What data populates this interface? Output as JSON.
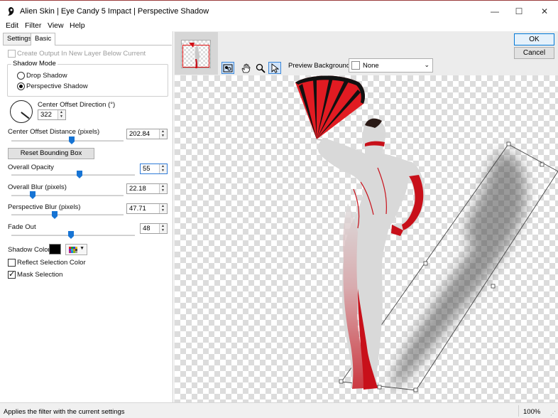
{
  "window": {
    "title": "Alien Skin | Eye Candy 5 Impact | Perspective Shadow",
    "minimize": "—",
    "maximize": "☐",
    "close": "✕"
  },
  "menu": [
    "Edit",
    "Filter",
    "View",
    "Help"
  ],
  "tabs": [
    {
      "label": "Settings",
      "active": false
    },
    {
      "label": "Basic",
      "active": true
    }
  ],
  "basic": {
    "create_output_label": "Create Output In New Layer Below Current",
    "create_output_checked": false,
    "shadow_mode_title": "Shadow Mode",
    "drop_shadow_label": "Drop Shadow",
    "perspective_shadow_label": "Perspective Shadow",
    "selected_mode": "Perspective Shadow",
    "direction_label": "Center Offset Direction (°)",
    "direction_value": "322",
    "distance_label": "Center Offset Distance (pixels)",
    "distance_value": "202.84",
    "reset_button": "Reset Bounding Box",
    "opacity_label": "Overall Opacity",
    "opacity_value": "55",
    "blur_label": "Overall Blur (pixels)",
    "blur_value": "22.18",
    "persp_blur_label": "Perspective Blur (pixels)",
    "persp_blur_value": "47.71",
    "fade_label": "Fade Out",
    "fade_value": "48",
    "shadow_color_label": "Shadow Color",
    "shadow_color": "#000000",
    "reflect_label": "Reflect Selection Color",
    "reflect_checked": false,
    "mask_label": "Mask Selection",
    "mask_checked": true
  },
  "preview": {
    "background_label": "Preview Background:",
    "background_value": "None",
    "tools": [
      "preview-toggle-icon",
      "hand-icon",
      "zoom-icon",
      "arrow-pointer-icon"
    ]
  },
  "buttons": {
    "ok": "OK",
    "cancel": "Cancel"
  },
  "status": {
    "text": "Applies the filter with the current settings",
    "zoom": "100%"
  },
  "colors": {
    "accent": "#1774d4",
    "fan_red": "#e11b22",
    "body_red": "#c8101a"
  }
}
